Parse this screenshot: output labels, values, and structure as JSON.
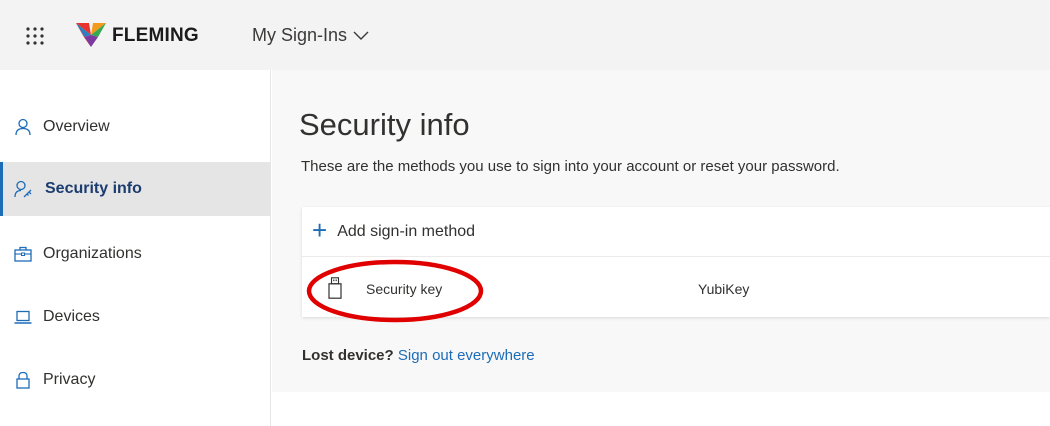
{
  "header": {
    "brand": "FLEMING",
    "app_title": "My Sign-Ins",
    "icons": {
      "waffle": "app-launcher-icon",
      "logo": "fleming-logo",
      "chevron": "chevron-down-icon"
    }
  },
  "sidebar": {
    "items": [
      {
        "label": "Overview",
        "icon": "person-icon",
        "active": false
      },
      {
        "label": "Security info",
        "icon": "person-key-icon",
        "active": true
      },
      {
        "label": "Organizations",
        "icon": "briefcase-icon",
        "active": false
      },
      {
        "label": "Devices",
        "icon": "laptop-icon",
        "active": false
      },
      {
        "label": "Privacy",
        "icon": "lock-icon",
        "active": false
      }
    ]
  },
  "main": {
    "title": "Security info",
    "subtitle": "These are the methods you use to sign into your account or reset your password.",
    "add_method_label": "Add sign-in method",
    "methods": [
      {
        "icon": "usb-key-icon",
        "label": "Security key",
        "detail": "YubiKey"
      }
    ],
    "lost_device_prefix": "Lost device?",
    "lost_device_link": "Sign out everywhere"
  },
  "colors": {
    "accent": "#1c6cb8",
    "active_nav_bg": "#e5e5e5",
    "topbar_bg": "#f3f3f3",
    "content_bg": "#f8f8f8",
    "annotation": "#e00000"
  }
}
